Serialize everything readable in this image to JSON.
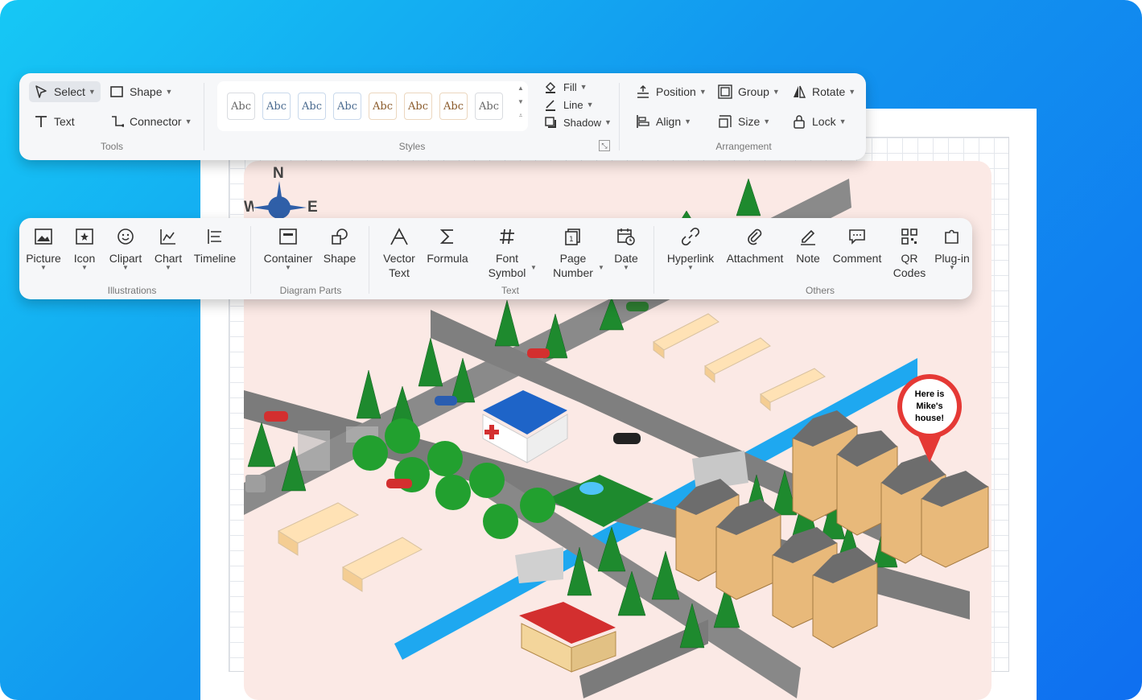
{
  "tools": {
    "select": "Select",
    "shape": "Shape",
    "text": "Text",
    "connector": "Connector",
    "group_label": "Tools"
  },
  "styles": {
    "swatches": [
      "Abc",
      "Abc",
      "Abc",
      "Abc",
      "Abc",
      "Abc",
      "Abc",
      "Abc"
    ],
    "fill": "Fill",
    "line": "Line",
    "shadow": "Shadow",
    "group_label": "Styles"
  },
  "arrangement": {
    "position": "Position",
    "group": "Group",
    "rotate": "Rotate",
    "align": "Align",
    "size": "Size",
    "lock": "Lock",
    "group_label": "Arrangement"
  },
  "illustrations": {
    "picture": "Picture",
    "icon": "Icon",
    "clipart": "Clipart",
    "chart": "Chart",
    "timeline": "Timeline",
    "group_label": "Illustrations"
  },
  "diagram_parts": {
    "container": "Container",
    "shape": "Shape",
    "group_label": "Diagram Parts"
  },
  "text_group": {
    "vector_text_1": "Vector",
    "vector_text_2": "Text",
    "formula": "Formula",
    "font_symbol_1": "Font",
    "font_symbol_2": "Symbol",
    "page_number_1": "Page",
    "page_number_2": "Number",
    "date": "Date",
    "group_label": "Text"
  },
  "others": {
    "hyperlink": "Hyperlink",
    "attachment": "Attachment",
    "note": "Note",
    "comment": "Comment",
    "qr_1": "QR",
    "qr_2": "Codes",
    "plugin": "Plug-in",
    "group_label": "Others"
  },
  "map": {
    "compass_n": "N",
    "compass_e": "E",
    "compass_w": "W",
    "callout_line1": "Here is",
    "callout_line2": "Mike's",
    "callout_line3": "house!"
  },
  "colors": {
    "accent_blue": "#1296ef",
    "canvas_bg": "#fbe9e5",
    "road": "#7b7b7b",
    "river": "#1ea8f0",
    "tree": "#1e8a2e",
    "callout": "#e53935"
  }
}
